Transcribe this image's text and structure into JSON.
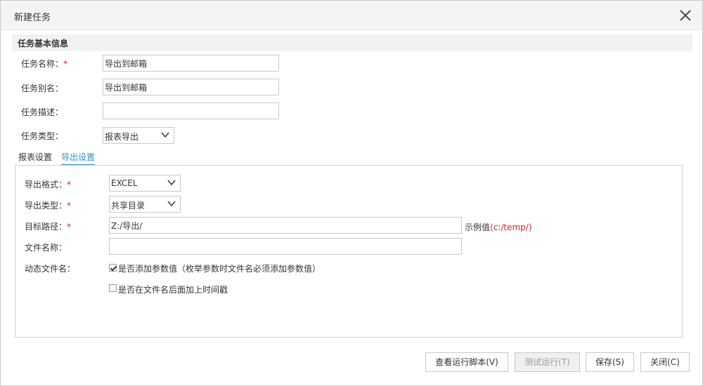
{
  "dialog": {
    "title": "新建任务"
  },
  "basic_info": {
    "section_title": "任务基本信息",
    "task_name": {
      "label": "任务名称：",
      "required": "*",
      "value": "导出到邮箱"
    },
    "task_alias": {
      "label": "任务别名：",
      "value": "导出到邮箱"
    },
    "task_desc": {
      "label": "任务描述：",
      "value": ""
    },
    "task_type": {
      "label": "任务类型：",
      "value": "报表导出"
    }
  },
  "tabs": [
    {
      "label": "报表设置",
      "active": false
    },
    {
      "label": "导出设置",
      "active": true
    }
  ],
  "export_settings": {
    "format": {
      "label": "导出格式：",
      "required": "*",
      "value": "EXCEL"
    },
    "export_type": {
      "label": "导出类型：",
      "required": "*",
      "value": "共享目录"
    },
    "target_path": {
      "label": "目标路径：",
      "required": "*",
      "value": "Z:/导出/",
      "hint_prefix": "示例值",
      "hint_example": "(c:/temp/)"
    },
    "file_name": {
      "label": "文件名称：",
      "value": ""
    },
    "dynamic_file": {
      "label": "动态文件名：",
      "add_param": {
        "label": "是否添加参数值（枚举参数时文件名必须添加参数值）",
        "checked": true
      },
      "add_timestamp": {
        "label": "是否在文件名后面加上时间戳",
        "checked": false
      }
    }
  },
  "footer": {
    "view_script": "查看运行脚本(V)",
    "test_run": "测试运行(T)",
    "save": "保存(S)",
    "close": "关闭(C)"
  }
}
